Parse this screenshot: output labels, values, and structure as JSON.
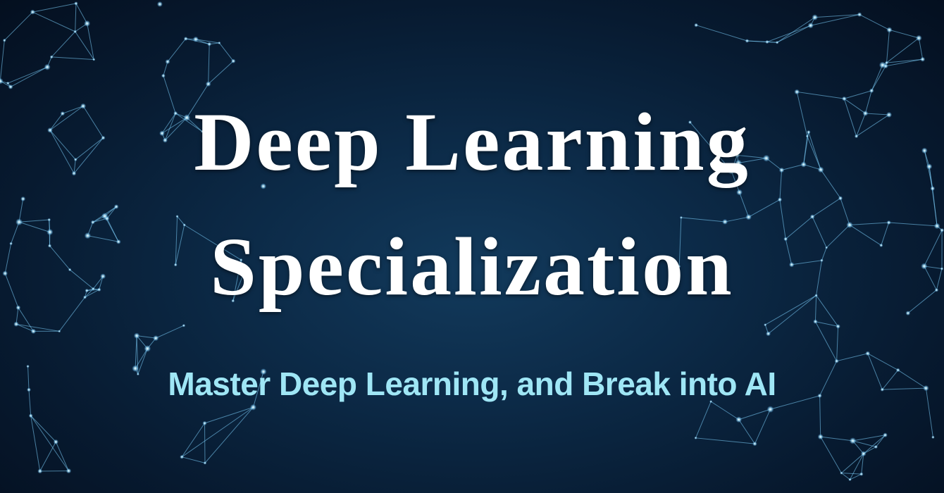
{
  "banner": {
    "title_line_1": "Deep Learning",
    "title_line_2": "Specialization",
    "subtitle": "Master Deep Learning, and Break into AI"
  },
  "colors": {
    "background": "#0a1a2e",
    "title": "#ffffff",
    "subtitle": "#9fe6f5",
    "network": "#7fd4ff"
  }
}
